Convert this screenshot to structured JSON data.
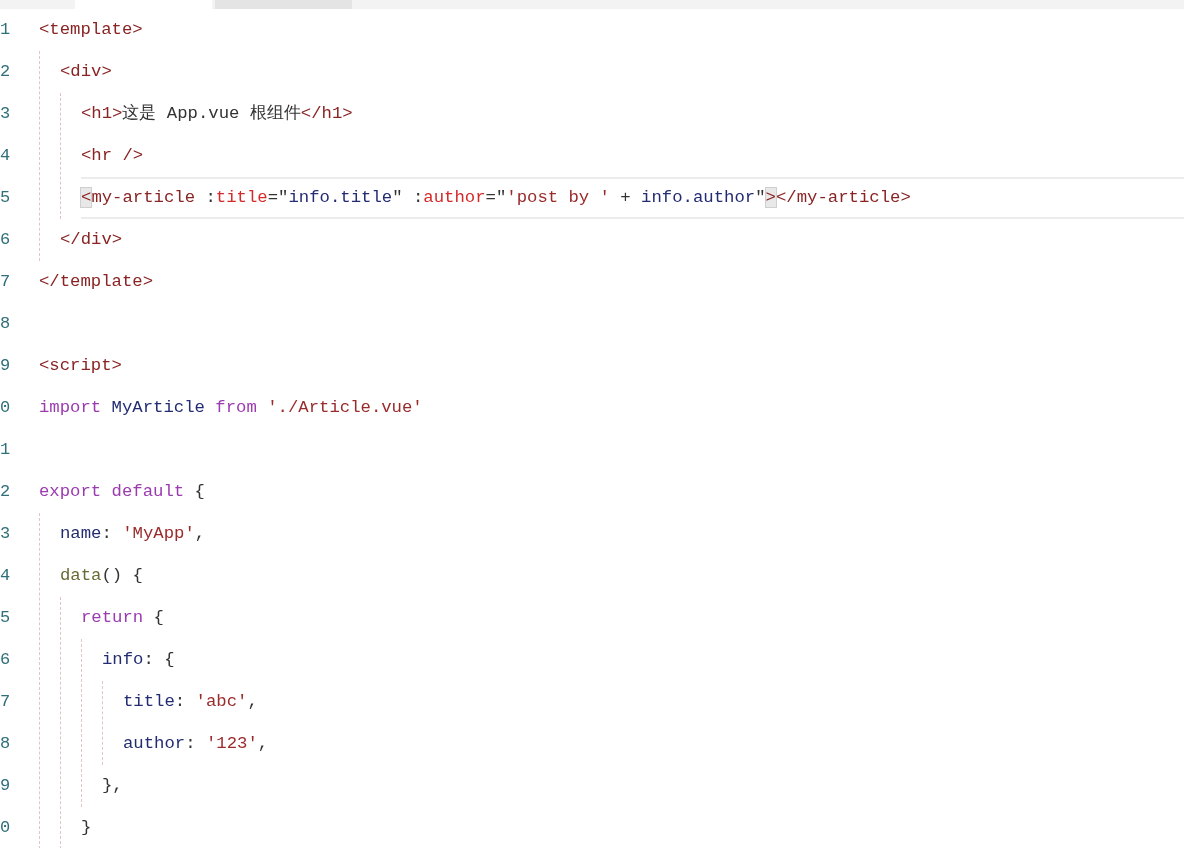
{
  "tabs": [
    {
      "selected": true
    },
    {
      "selected": false
    }
  ],
  "editor": {
    "lines": [
      {
        "number": "1",
        "current": false,
        "tokens": [
          {
            "kind": "tag",
            "text": "<template>"
          }
        ],
        "children": [
          {
            "number": "2",
            "current": false,
            "tokens": [
              {
                "kind": "tag",
                "text": "<div>"
              }
            ],
            "children": [
              {
                "number": "3",
                "current": false,
                "tokens": [
                  {
                    "kind": "tag",
                    "text": "<h1>"
                  },
                  {
                    "kind": "plain",
                    "text": "这是 App.vue 根组件"
                  },
                  {
                    "kind": "tag",
                    "text": "</h1>"
                  }
                ]
              },
              {
                "number": "4",
                "current": false,
                "tokens": [
                  {
                    "kind": "tag",
                    "text": "<hr />"
                  }
                ]
              },
              {
                "number": "5",
                "current": true,
                "tokens": [
                  {
                    "kind": "bracket",
                    "text": "<"
                  },
                  {
                    "kind": "tag",
                    "text": "my-article "
                  },
                  {
                    "kind": "plain",
                    "text": ":"
                  },
                  {
                    "kind": "attr",
                    "text": "title"
                  },
                  {
                    "kind": "plain",
                    "text": "=\""
                  },
                  {
                    "kind": "value",
                    "text": "info.title"
                  },
                  {
                    "kind": "plain",
                    "text": "\" :"
                  },
                  {
                    "kind": "attr",
                    "text": "author"
                  },
                  {
                    "kind": "plain",
                    "text": "=\""
                  },
                  {
                    "kind": "string",
                    "text": "'post by '"
                  },
                  {
                    "kind": "plain",
                    "text": " + "
                  },
                  {
                    "kind": "value",
                    "text": "info.author"
                  },
                  {
                    "kind": "plain",
                    "text": "\""
                  },
                  {
                    "kind": "bracket",
                    "text": ">"
                  },
                  {
                    "kind": "tag",
                    "text": "</my-article>"
                  }
                ]
              }
            ]
          },
          {
            "number": "6",
            "current": false,
            "tokens": [
              {
                "kind": "tag",
                "text": "</div>"
              }
            ]
          }
        ]
      },
      {
        "number": "7",
        "current": false,
        "tokens": [
          {
            "kind": "tag",
            "text": "</template>"
          }
        ]
      },
      {
        "number": "8",
        "current": false
      },
      {
        "number": "9",
        "current": false,
        "tokens": [
          {
            "kind": "tag",
            "text": "<script>"
          }
        ]
      },
      {
        "number": "0",
        "current": false,
        "tokens": [
          {
            "kind": "keyword",
            "text": "import "
          },
          {
            "kind": "value",
            "text": "MyArticle "
          },
          {
            "kind": "keyword",
            "text": "from "
          },
          {
            "kind": "string",
            "text": "'./Article.vue'"
          }
        ]
      },
      {
        "number": "1",
        "current": false
      },
      {
        "number": "2",
        "current": false,
        "tokens": [
          {
            "kind": "keyword",
            "text": "export default"
          },
          {
            "kind": "plain",
            "text": " {"
          }
        ],
        "children": [
          {
            "number": "3",
            "current": false,
            "tokens": [
              {
                "kind": "value",
                "text": "name"
              },
              {
                "kind": "plain",
                "text": ": "
              },
              {
                "kind": "string",
                "text": "'MyApp'"
              },
              {
                "kind": "plain",
                "text": ","
              }
            ]
          },
          {
            "number": "4",
            "current": false,
            "tokens": [
              {
                "kind": "func",
                "text": "data"
              },
              {
                "kind": "plain",
                "text": "() {"
              }
            ],
            "children": [
              {
                "number": "5",
                "current": false,
                "tokens": [
                  {
                    "kind": "keyword",
                    "text": "return"
                  },
                  {
                    "kind": "plain",
                    "text": " {"
                  }
                ],
                "children": [
                  {
                    "number": "6",
                    "current": false,
                    "tokens": [
                      {
                        "kind": "value",
                        "text": "info"
                      },
                      {
                        "kind": "plain",
                        "text": ": {"
                      }
                    ],
                    "children": [
                      {
                        "number": "7",
                        "current": false,
                        "tokens": [
                          {
                            "kind": "value",
                            "text": "title"
                          },
                          {
                            "kind": "plain",
                            "text": ": "
                          },
                          {
                            "kind": "string",
                            "text": "'abc'"
                          },
                          {
                            "kind": "plain",
                            "text": ","
                          }
                        ]
                      },
                      {
                        "number": "8",
                        "current": false,
                        "tokens": [
                          {
                            "kind": "value",
                            "text": "author"
                          },
                          {
                            "kind": "plain",
                            "text": ": "
                          },
                          {
                            "kind": "string",
                            "text": "'123'"
                          },
                          {
                            "kind": "plain",
                            "text": ","
                          }
                        ]
                      }
                    ]
                  },
                  {
                    "number": "9",
                    "current": false,
                    "tokens": [
                      {
                        "kind": "plain",
                        "text": "},"
                      }
                    ]
                  }
                ]
              },
              {
                "number": "0",
                "current": false,
                "tokens": [
                  {
                    "kind": "plain",
                    "text": "}"
                  }
                ]
              }
            ]
          }
        ]
      }
    ]
  }
}
